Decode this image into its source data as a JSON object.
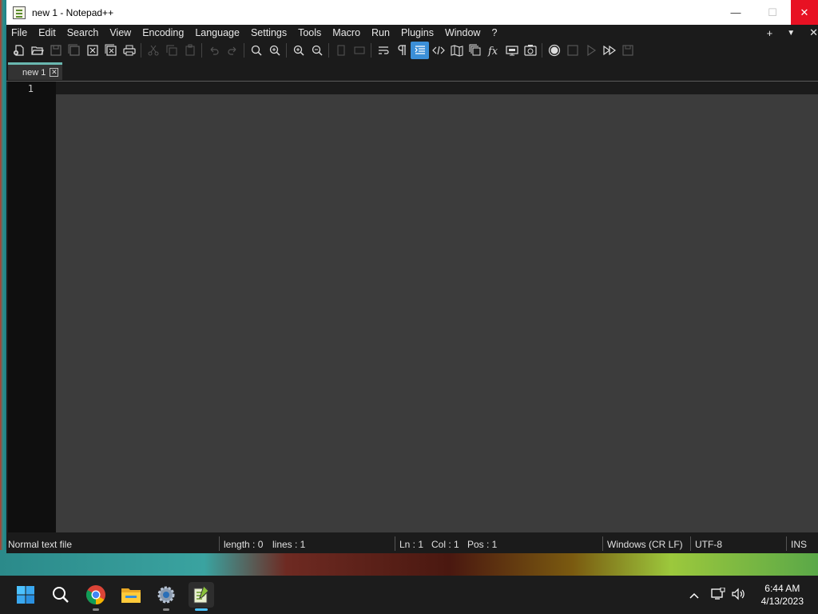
{
  "window": {
    "title": "new 1 - Notepad++",
    "controls": {
      "minimize": "—",
      "maximize": "☐",
      "close": "✕"
    }
  },
  "menu": {
    "items": [
      "File",
      "Edit",
      "Search",
      "View",
      "Encoding",
      "Language",
      "Settings",
      "Tools",
      "Macro",
      "Run",
      "Plugins",
      "Window",
      "?"
    ],
    "right": {
      "add": "+",
      "dropdown": "▼",
      "close": "✕"
    }
  },
  "toolbar": {
    "icons": [
      "new-file-icon",
      "open-file-icon",
      "save-icon",
      "save-all-icon",
      "close-icon",
      "close-all-icon",
      "print-icon",
      "cut-icon",
      "copy-icon",
      "paste-icon",
      "undo-icon",
      "redo-icon",
      "find-icon",
      "replace-icon",
      "zoom-in-icon",
      "zoom-out-icon",
      "sync-vertical-icon",
      "sync-horizontal-icon",
      "word-wrap-icon",
      "show-all-chars-icon",
      "indent-guide-icon",
      "language-icon",
      "document-map-icon",
      "doc-list-icon",
      "function-list-icon",
      "folder-workspace-icon",
      "monitoring-icon",
      "record-macro-icon",
      "stop-record-icon",
      "play-macro-icon",
      "run-macro-multiple-icon",
      "save-macro-icon"
    ],
    "active": "indent-guide-icon"
  },
  "tabs": [
    {
      "label": "new 1",
      "close": "✕"
    }
  ],
  "editor": {
    "line_numbers": [
      "1"
    ],
    "content": ""
  },
  "status": {
    "file_type": "Normal text file",
    "length": "length : 0",
    "lines": "lines : 1",
    "ln": "Ln : 1",
    "col": "Col : 1",
    "pos": "Pos : 1",
    "eol": "Windows (CR LF)",
    "encoding": "UTF-8",
    "mode": "INS"
  },
  "taskbar": {
    "apps": [
      "start-icon",
      "search-icon",
      "chrome-icon",
      "file-explorer-icon",
      "settings-icon",
      "notepadpp-icon"
    ],
    "active": "notepadpp-icon",
    "tray": {
      "chevron": "^"
    },
    "clock": {
      "time": "6:44 AM",
      "date": "4/13/2023"
    }
  },
  "colors": {
    "close_red": "#e81123",
    "tab_accent": "#6ab8b0",
    "active_toolbar": "#3b8fd8",
    "editor_bg": "#3c3c3c",
    "chrome_bg": "#1b1b1b"
  }
}
